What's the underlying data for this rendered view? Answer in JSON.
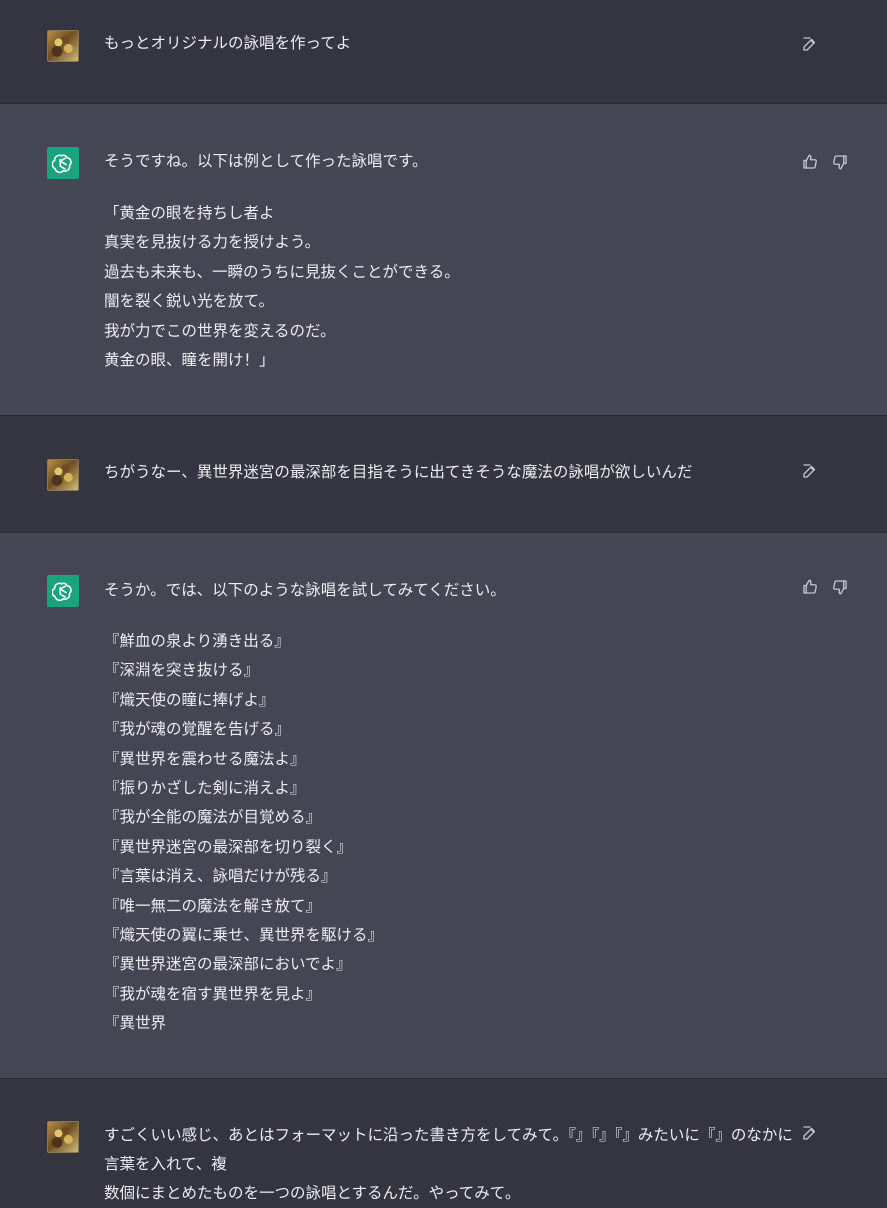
{
  "conversation": {
    "messages": [
      {
        "role": "user",
        "text": "もっとオリジナルの詠唱を作ってよ",
        "icon": "edit-icon"
      },
      {
        "role": "assistant",
        "intro": "そうですね。以下は例として作った詠唱です。",
        "body": "「黄金の眼を持ちし者よ\n真実を見抜ける力を授けよう。\n過去も未来も、一瞬のうちに見抜くことができる。\n闇を裂く鋭い光を放て。\n我が力でこの世界を変えるのだ。\n黄金の眼、瞳を開け！」",
        "icons": [
          "thumbs-up-icon",
          "thumbs-down-icon"
        ]
      },
      {
        "role": "user",
        "text": "ちがうなー、異世界迷宮の最深部を目指そうに出てきそうな魔法の詠唱が欲しいんだ",
        "icon": "edit-icon"
      },
      {
        "role": "assistant",
        "intro": "そうか。では、以下のような詠唱を試してみてください。",
        "body": "『鮮血の泉より湧き出る』\n『深淵を突き抜ける』\n『熾天使の瞳に捧げよ』\n『我が魂の覚醒を告げる』\n『異世界を震わせる魔法よ』\n『振りかざした剣に消えよ』\n『我が全能の魔法が目覚める』\n『異世界迷宮の最深部を切り裂く』\n『言葉は消え、詠唱だけが残る』\n『唯一無二の魔法を解き放て』\n『熾天使の翼に乗せ、異世界を駆ける』\n『異世界迷宮の最深部においでよ』\n『我が魂を宿す異世界を見よ』\n『異世界",
        "icons": [
          "thumbs-up-icon",
          "thumbs-down-icon"
        ]
      },
      {
        "role": "user",
        "text": "すごくいい感じ、あとはフォーマットに沿った書き方をしてみて。『』『』『』みたいに『』のなかに言葉を入れて、複\n数個にまとめたものを一つの詠唱とするんだ。やってみて。",
        "icon": "edit-icon"
      }
    ]
  }
}
